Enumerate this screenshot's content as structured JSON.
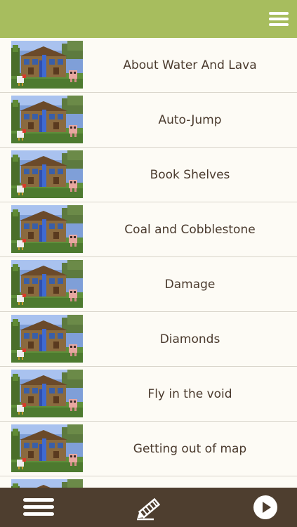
{
  "header": {
    "menu_icon": "hamburger-menu-icon"
  },
  "list": {
    "thumbnail_icon": "minecraft-house-thumbnail",
    "items": [
      {
        "label": "About Water And Lava"
      },
      {
        "label": "Auto-Jump"
      },
      {
        "label": "Book Shelves"
      },
      {
        "label": "Coal and Cobblestone"
      },
      {
        "label": "Damage"
      },
      {
        "label": "Diamonds"
      },
      {
        "label": "Fly in the void"
      },
      {
        "label": "Getting out of map"
      },
      {
        "label": ""
      }
    ]
  },
  "footer": {
    "menu_icon": "hamburger-menu-icon",
    "edit_icon": "pencil-icon",
    "play_icon": "play-icon"
  },
  "colors": {
    "header_bg": "#a7bd5e",
    "footer_bg": "#4e3e2f",
    "list_bg": "#fdfbf5",
    "text": "#4a3a2d",
    "divider": "#d9d5cb"
  }
}
